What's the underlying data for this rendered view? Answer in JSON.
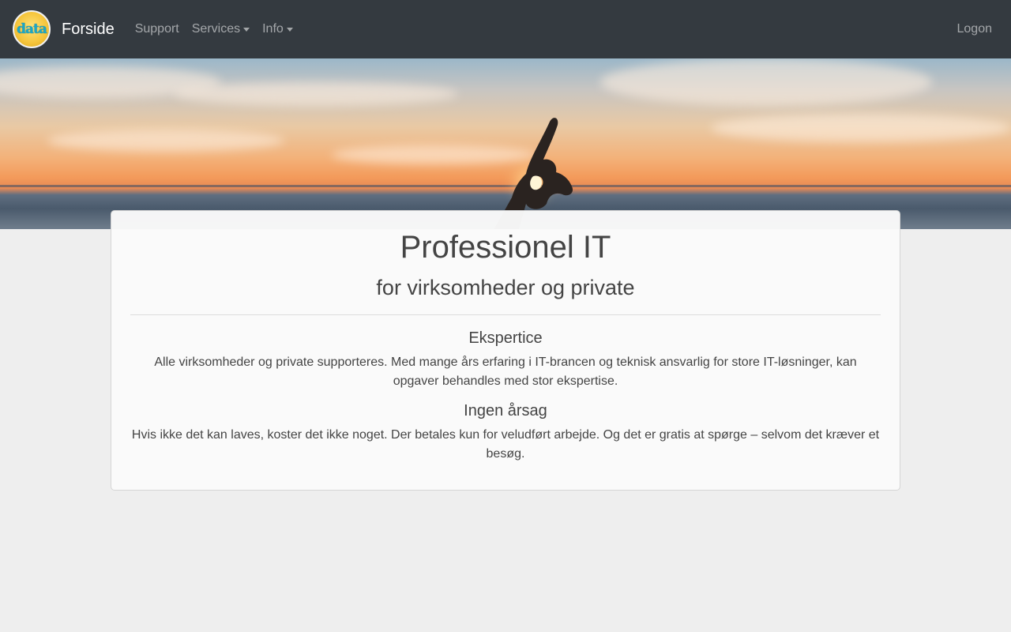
{
  "navbar": {
    "logo_text": "data",
    "brand": "Forside",
    "links": [
      {
        "label": "Support",
        "dropdown": false
      },
      {
        "label": "Services",
        "dropdown": true
      },
      {
        "label": "Info",
        "dropdown": true
      }
    ],
    "logon": "Logon"
  },
  "main": {
    "title": "Professionel IT",
    "subtitle": "for virksomheder og private",
    "sections": [
      {
        "heading": "Ekspertice",
        "text": "Alle virksomheder og private supporteres. Med mange års erfaring i IT-brancen og teknisk ansvarlig for store IT-løsninger, kan opgaver behandles med stor ekspertise."
      },
      {
        "heading": "Ingen årsag",
        "text": "Hvis ikke det kan laves, koster det ikke noget. Der betales kun for veludført arbejde. Og det er gratis at spørge – selvom det kræver et besøg."
      }
    ]
  },
  "colors": {
    "navbar_bg": "#343a40",
    "page_bg": "#eeeeee",
    "card_bg": "#fafafa"
  }
}
